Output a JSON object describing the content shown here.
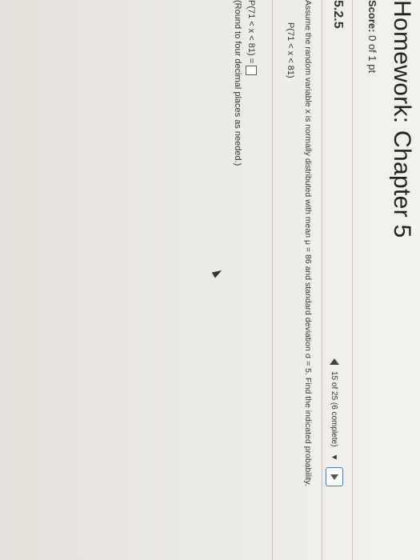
{
  "header": {
    "title": "Homework: Chapter 5",
    "score_label": "Score:",
    "score_value": "0 of 1 pt"
  },
  "question": {
    "number": "5.2.5",
    "nav_text": "15 of 25 (6 complete)",
    "prompt": "Assume the random variable x is normally distributed with mean μ = 86 and standard deviation σ = 5. Find the indicated probability.",
    "probability": "P(71 < x < 81)",
    "answer_label": "P(71 < x < 81) =",
    "answer_value": "",
    "hint": "(Round to four decimal places as needed.)"
  }
}
